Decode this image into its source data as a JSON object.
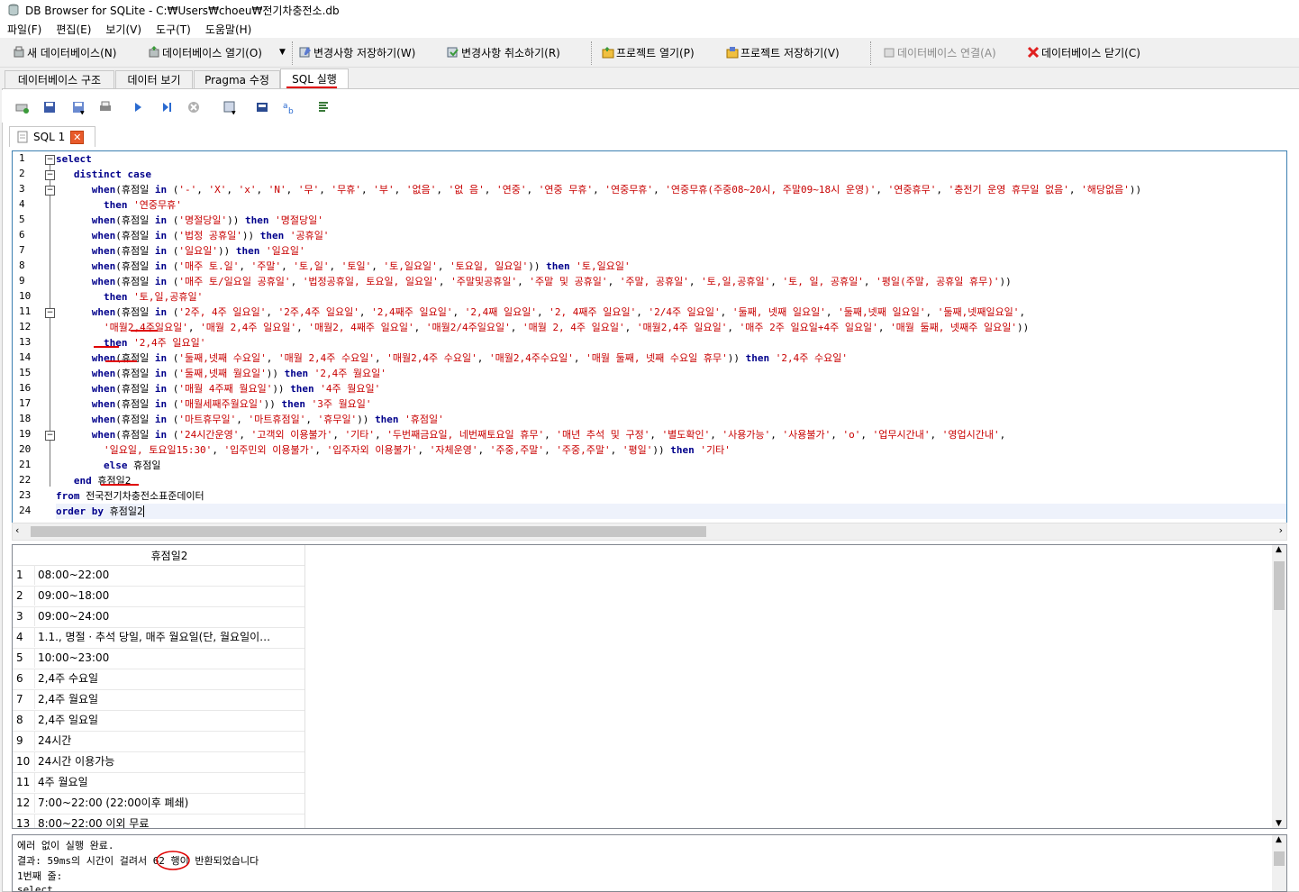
{
  "window": {
    "title": "DB Browser for SQLite - C:₩Users₩choeu₩전기차충전소.db"
  },
  "menu": [
    "파일(F)",
    "편집(E)",
    "보기(V)",
    "도구(T)",
    "도움말(H)"
  ],
  "toolbar": {
    "new_db": "새 데이터베이스(N)",
    "open_db": "데이터베이스 열기(O)",
    "write_changes": "변경사항 저장하기(W)",
    "revert_changes": "변경사항 취소하기(R)",
    "open_project": "프로젝트 열기(P)",
    "save_project": "프로젝트 저장하기(V)",
    "attach_db": "데이터베이스 연결(A)",
    "close_db": "데이터베이스 닫기(C)"
  },
  "tabs": [
    "데이터베이스 구조",
    "데이터 보기",
    "Pragma 수정",
    "SQL 실행"
  ],
  "editor_tab": {
    "label": "SQL 1"
  },
  "editor": {
    "line_numbers": [
      "1",
      "2",
      "3",
      "4",
      "5",
      "6",
      "7",
      "8",
      "9",
      "10",
      "11",
      "12",
      "13",
      "14",
      "15",
      "16",
      "17",
      "18",
      "19",
      "20",
      "21",
      "22",
      "23",
      "24"
    ]
  },
  "results": {
    "column": "휴점일2",
    "rows": [
      {
        "n": "1",
        "v": "08:00~22:00"
      },
      {
        "n": "2",
        "v": "09:00~18:00"
      },
      {
        "n": "3",
        "v": "09:00~24:00"
      },
      {
        "n": "4",
        "v": "1.1., 명절 · 추석 당일, 매주 월요일(단, 월요일이…"
      },
      {
        "n": "5",
        "v": "10:00~23:00"
      },
      {
        "n": "6",
        "v": "2,4주 수요일"
      },
      {
        "n": "7",
        "v": "2,4주 월요일"
      },
      {
        "n": "8",
        "v": "2,4주 일요일"
      },
      {
        "n": "9",
        "v": "24시간"
      },
      {
        "n": "10",
        "v": "24시간 이용가능"
      },
      {
        "n": "11",
        "v": "4주 월요일"
      },
      {
        "n": "12",
        "v": "7:00~22:00 (22:00이후 폐쇄)"
      },
      {
        "n": "13",
        "v": "8:00~22:00 이외 무료"
      }
    ]
  },
  "messages": {
    "line1": "에러 없이 실행 완료.",
    "line2_prefix": "결과: 59ms의 시간이 걸려서 ",
    "row_count": "62",
    "line2_suffix": " 행이 반환되었습니다",
    "line3": "1번째 줄:",
    "line4": "select"
  },
  "colors": {
    "keyword": "#00008b",
    "string": "#c80000",
    "annotation": "#e00000"
  }
}
